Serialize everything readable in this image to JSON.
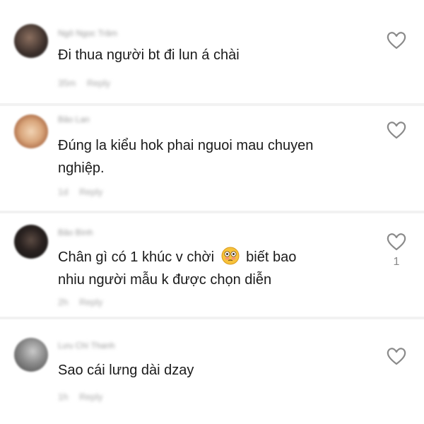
{
  "comments": [
    {
      "username": "Ngô Ngọc Trâm",
      "text": "Đi thua người bt đi lun á chài",
      "time": "35m",
      "reply_label": "Reply",
      "like_count": "",
      "avatar_colors": [
        "#3a2e2a",
        "#8b6f5f"
      ]
    },
    {
      "username": "Bảo Lan",
      "text_line1": "Đúng la kiểu hok phai nguoi mau chuyen",
      "text_line2": "nghiệp.",
      "time": "1d",
      "reply_label": "Reply",
      "like_count": "",
      "avatar_colors": [
        "#c98a5e",
        "#f1d3b3"
      ]
    },
    {
      "username": "Bảo Bình",
      "text_line1_before": "Chân gì có 1 khúc v chời",
      "emoji": "flushed-face",
      "text_line1_after": "biết bao",
      "text_line2": "nhiu người mẫu k được chọn diễn",
      "time": "2h",
      "reply_label": "Reply",
      "like_count": "1",
      "avatar_colors": [
        "#1c1c1c",
        "#5a4a42"
      ]
    },
    {
      "username": "Lưu Chí Thanh",
      "text": "Sao cái lưng dài dzay",
      "time": "1h",
      "reply_label": "Reply",
      "like_count": "",
      "avatar_colors": [
        "#6b6b6b",
        "#c9c9c9"
      ]
    }
  ],
  "colors": {
    "text": "#1a1a1a",
    "muted": "#a8a8a8",
    "heart_stroke": "#8a8a8a",
    "divider": "#f2f2f2"
  },
  "icons": {
    "like": "heart-outline-icon",
    "emoji": "flushed-face-emoji"
  }
}
